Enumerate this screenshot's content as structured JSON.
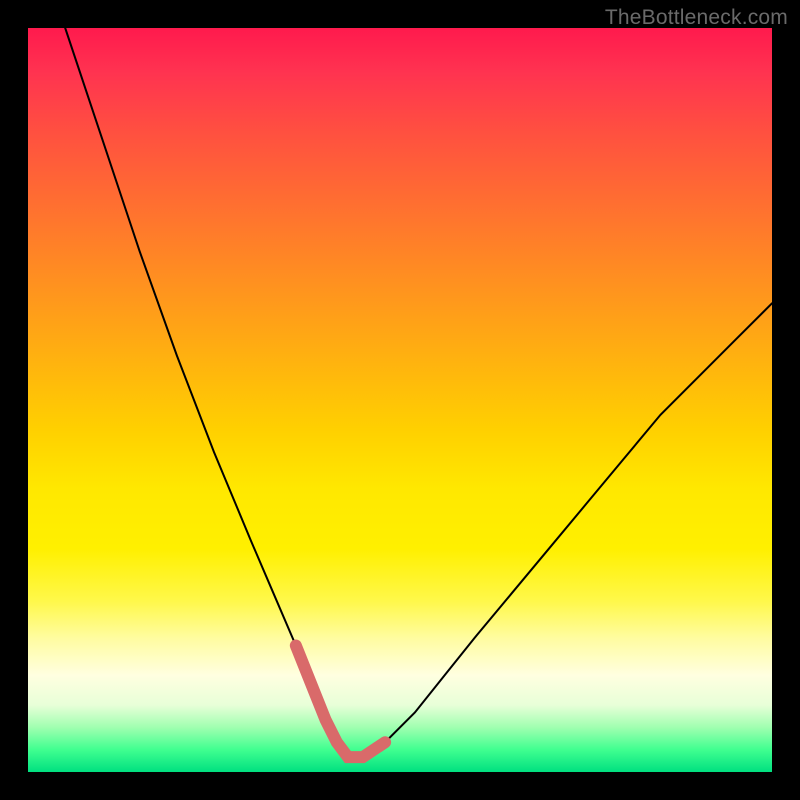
{
  "watermark": "TheBottleneck.com",
  "colors": {
    "curve": "#000000",
    "highlight": "#d96a6a",
    "background_top": "#ff1a4d",
    "background_bottom": "#00e080",
    "frame": "#000000"
  },
  "chart_data": {
    "type": "line",
    "title": "",
    "xlabel": "",
    "ylabel": "",
    "xlim": [
      0,
      100
    ],
    "ylim": [
      0,
      100
    ],
    "series": [
      {
        "name": "bottleneck_curve",
        "x": [
          5,
          10,
          15,
          20,
          25,
          30,
          33,
          36,
          38,
          40,
          41.5,
          43,
          45,
          48,
          52,
          56,
          60,
          65,
          70,
          75,
          80,
          85,
          90,
          95,
          100
        ],
        "y": [
          100,
          85,
          70,
          56,
          43,
          31,
          24,
          17,
          12,
          7,
          4,
          2,
          2,
          4,
          8,
          13,
          18,
          24,
          30,
          36,
          42,
          48,
          53,
          58,
          63
        ]
      }
    ],
    "highlight_range": {
      "description": "bottom segment of curve rendered thick",
      "x_start": 36,
      "x_end": 50
    },
    "annotations": [
      {
        "text": "TheBottleneck.com",
        "role": "watermark",
        "position": "top-right"
      }
    ]
  }
}
